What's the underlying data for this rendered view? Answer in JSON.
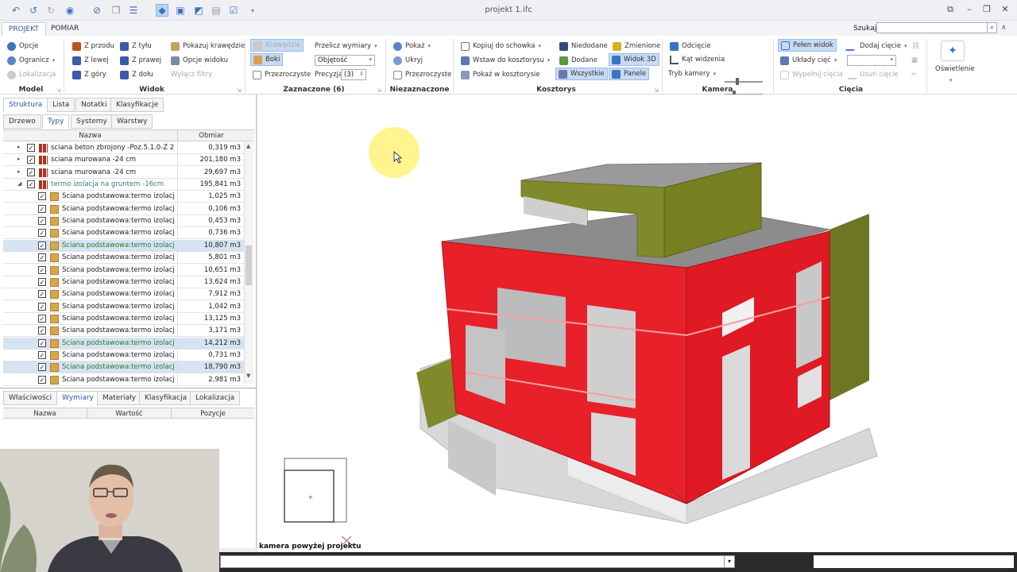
{
  "window": {
    "title": "projekt 1.ifc"
  },
  "menu": {
    "tabs": [
      "PROJEKT",
      "POMIAR"
    ],
    "search_label": "Szukaj:",
    "search_value": ""
  },
  "ribbon": {
    "model": {
      "items": [
        "Opcje",
        "Ogranicz",
        "Lokalizacja"
      ],
      "label": "Model"
    },
    "widok": {
      "items": [
        "Z przodu",
        "Z tyłu",
        "Pokazuj krawędzie",
        "Z lewej",
        "Z prawej",
        "Opcje widoku",
        "Z góry",
        "Z dołu",
        "Wyłącz filtry"
      ],
      "label": "Widok"
    },
    "zaznaczone": {
      "items": [
        "Krawędzie",
        "Boki",
        "Przezroczyste"
      ],
      "recalc": "Przelicz wymiary",
      "mode": "Objętość",
      "precision_label": "Precyzja",
      "precision_value": "(3)",
      "label": "Zaznaczone (6)"
    },
    "niezaznaczone": {
      "items": [
        "Pokaż",
        "Ukryj",
        "Przezroczyste"
      ],
      "label": "Niezaznaczone"
    },
    "kosztorys": {
      "items": [
        "Kopiuj do schowka",
        "Wstaw do kosztorysu",
        "Pokaż w kosztorysie",
        "Niedodane",
        "Zmienione",
        "Dodane",
        "Widok 3D",
        "Wszystkie",
        "Panele"
      ],
      "label": "Kosztorys"
    },
    "kamera": {
      "items": [
        "Odcięcie",
        "Kąt widzenia",
        "Tryb kamery"
      ],
      "label": "Kamera"
    },
    "ciecia": {
      "items": [
        "Pełen widok",
        "Dodaj cięcie",
        "Układy cięć",
        "Wypełnij cięcia",
        "Usuń cięcie"
      ],
      "label": "Cięcia"
    },
    "oswietlenie": {
      "label": "Oświetlenie"
    }
  },
  "panel": {
    "tabs_top": [
      "Struktura",
      "Lista",
      "Notatki",
      "Klasyfikacje"
    ],
    "tabs_sub": [
      "Drzewo",
      "Typy",
      "Systemy",
      "Warstwy"
    ],
    "columns": [
      "Nazwa",
      "Obmiar"
    ],
    "rows": [
      {
        "name": "sciana beton zbrojony -Poz.5.1.0-Z    2...",
        "value": "0,319 m3"
      },
      {
        "name": "sciana murowana  -24 cm",
        "value": "201,180 m3"
      },
      {
        "name": "sciana murowana  -24 cm",
        "value": "29,697 m3"
      },
      {
        "name": "termo izolacja na gruntem -16cm",
        "value": "195,841 m3"
      },
      {
        "name": "Ściana podstawowa:termo izolacja...",
        "value": "1,025 m3"
      },
      {
        "name": "Ściana podstawowa:termo izolacja...",
        "value": "0,106 m3"
      },
      {
        "name": "Ściana podstawowa:termo izolacja...",
        "value": "0,453 m3"
      },
      {
        "name": "Ściana podstawowa:termo izolacja...",
        "value": "0,736 m3"
      },
      {
        "name": "Ściana podstawowa:termo izolacja...",
        "value": "10,807 m3"
      },
      {
        "name": "Ściana podstawowa:termo izolacja...",
        "value": "5,801 m3"
      },
      {
        "name": "Ściana podstawowa:termo izolacja...",
        "value": "10,651 m3"
      },
      {
        "name": "Ściana podstawowa:termo izolacja...",
        "value": "13,624 m3"
      },
      {
        "name": "Ściana podstawowa:termo izolacja...",
        "value": "7,912 m3"
      },
      {
        "name": "Ściana podstawowa:termo izolacja...",
        "value": "1,042 m3"
      },
      {
        "name": "Ściana podstawowa:termo izolacja...",
        "value": "13,125 m3"
      },
      {
        "name": "Ściana podstawowa:termo izolacja...",
        "value": "3,171 m3"
      },
      {
        "name": "Ściana podstawowa:termo izolacja...",
        "value": "14,212 m3"
      },
      {
        "name": "Ściana podstawowa:termo izolacja...",
        "value": "0,731 m3"
      },
      {
        "name": "Ściana podstawowa:termo izolacja...",
        "value": "18,790 m3"
      },
      {
        "name": "Ściana podstawowa:termo izolacja...",
        "value": "2,981 m3"
      }
    ],
    "props_tabs": [
      "Właściwości",
      "Wymiary",
      "Materiały",
      "Klasyfikacja",
      "Lokalizacja"
    ],
    "props_columns": [
      "Nazwa",
      "Wartość",
      "Pozycje"
    ]
  },
  "viewport": {
    "camera_label": "kamera powyżej projektu"
  },
  "colors": {
    "accent": "#2a5aa8",
    "wall_red": "#e8202a",
    "wall_olive": "#808a2a",
    "slab": "#8c8c8c"
  }
}
